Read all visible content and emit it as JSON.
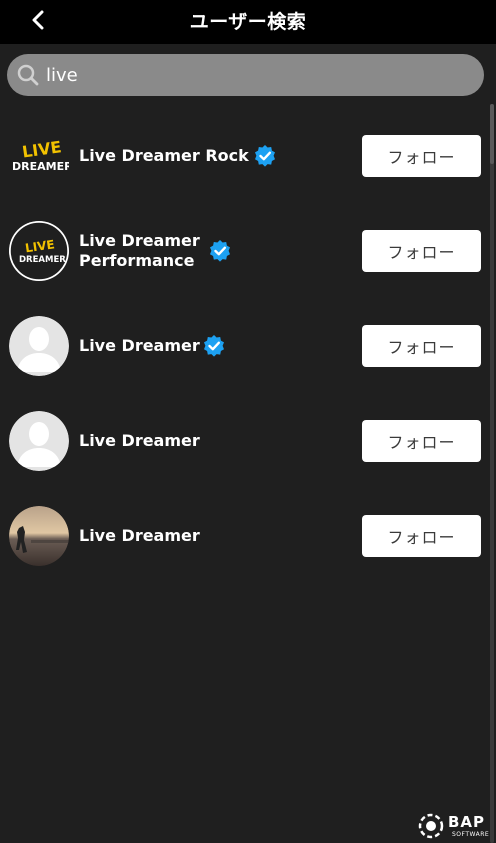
{
  "header": {
    "title": "ユーザー検索"
  },
  "search": {
    "value": "live",
    "placeholder": ""
  },
  "results": [
    {
      "name_line1": "Live Dreamer Rock",
      "name_line2": "",
      "verified": true,
      "avatar": "live-dreamer-logo-square",
      "follow_label": "フォロー"
    },
    {
      "name_line1": "Live Dreamer",
      "name_line2": "Performance",
      "verified": true,
      "avatar": "live-dreamer-logo-round",
      "follow_label": "フォロー"
    },
    {
      "name_line1": "Live Dreamer",
      "name_line2": "",
      "verified": true,
      "avatar": "default-user-avatar",
      "follow_label": "フォロー"
    },
    {
      "name_line1": "Live Dreamer",
      "name_line2": "",
      "verified": false,
      "avatar": "default-user-avatar",
      "follow_label": "フォロー"
    },
    {
      "name_line1": "Live Dreamer",
      "name_line2": "",
      "verified": false,
      "avatar": "photo-avatar",
      "follow_label": "フォロー"
    }
  ],
  "footer": {
    "logo_text": "BAP",
    "logo_subtext": "SOFTWARE"
  },
  "colors": {
    "background": "#1f1f1f",
    "header": "#000000",
    "search_bg": "#8a8a8a",
    "verified": "#1da1f2",
    "button_bg": "#ffffff",
    "logo_yellow": "#f2c200"
  }
}
